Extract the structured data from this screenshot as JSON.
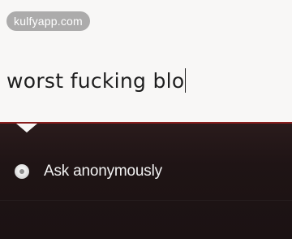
{
  "watermark": {
    "text": "kulfyapp.com"
  },
  "compose": {
    "text": "worst fucking blo"
  },
  "options": {
    "anonymous_label": "Ask anonymously"
  },
  "colors": {
    "accent": "#8a1e1e",
    "panel_background": "#1f1415",
    "compose_background": "#f8f7f6"
  },
  "icons": {
    "radio": "radio-icon"
  }
}
